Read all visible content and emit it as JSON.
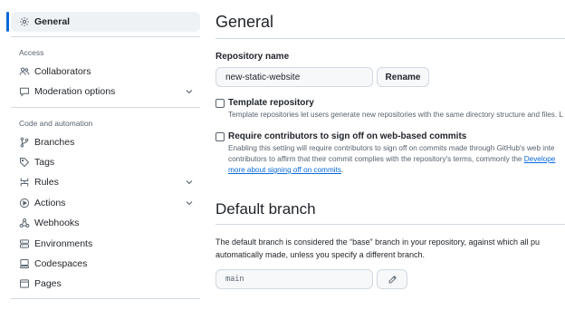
{
  "sidebar": {
    "general": {
      "label": "General",
      "icon": "gear-icon"
    },
    "sections": {
      "access": "Access",
      "code_automation": "Code and automation"
    },
    "items": [
      {
        "label": "Collaborators",
        "icon": "people-icon"
      },
      {
        "label": "Moderation options",
        "icon": "comment-icon"
      },
      {
        "label": "Branches",
        "icon": "branch-icon"
      },
      {
        "label": "Tags",
        "icon": "tag-icon"
      },
      {
        "label": "Rules",
        "icon": "rules-icon"
      },
      {
        "label": "Actions",
        "icon": "play-icon"
      },
      {
        "label": "Webhooks",
        "icon": "webhook-icon"
      },
      {
        "label": "Environments",
        "icon": "server-icon"
      },
      {
        "label": "Codespaces",
        "icon": "codespaces-icon"
      },
      {
        "label": "Pages",
        "icon": "browser-icon"
      }
    ]
  },
  "main": {
    "title": "General",
    "repo_name_label": "Repository name",
    "repo_name_value": "new-static-website",
    "rename_label": "Rename",
    "template": {
      "title": "Template repository",
      "desc": "Template repositories let users generate new repositories with the same directory structure and files. L"
    },
    "signoff": {
      "title": "Require contributors to sign off on web-based commits",
      "desc1": "Enabling this setting will require contributors to sign off on commits made through GitHub's web inte",
      "desc2_prefix": "contributors to affirm that their commit complies with the repository's terms, commonly the ",
      "desc2_link": "Develope",
      "desc3_link": "more about signing off on commits",
      "desc3_suffix": "."
    },
    "default_branch": {
      "title": "Default branch",
      "para1": "The default branch is considered the “base” branch in your repository, against which all pu",
      "para2": "automatically made, unless you specify a different branch.",
      "value": "main"
    }
  },
  "colors": {
    "accent": "#0969da",
    "border": "#d1d9e0",
    "muted": "#59636e"
  }
}
